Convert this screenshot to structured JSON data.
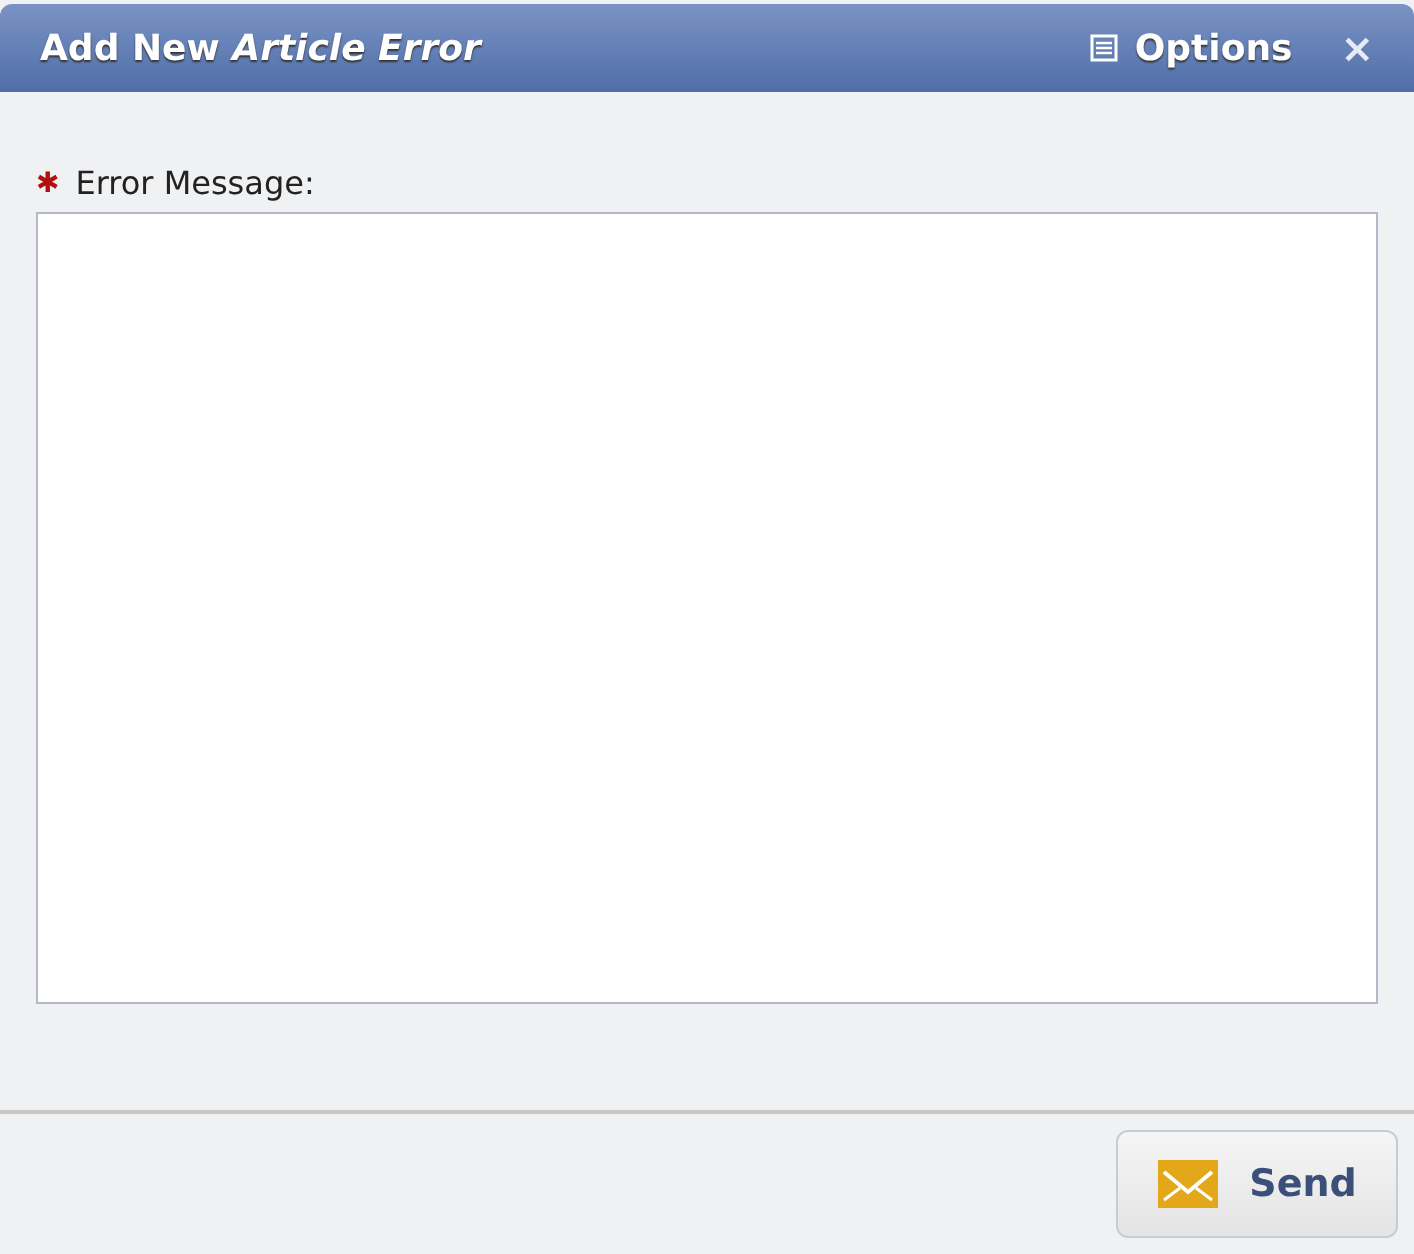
{
  "window": {
    "title": "Add New *Article Error*",
    "options_label": "Options",
    "close": "×"
  },
  "field": {
    "required_mark": "✱",
    "label": "Error Message:"
  },
  "buttons": [
    {
      "label": "Send"
    }
  ]
}
